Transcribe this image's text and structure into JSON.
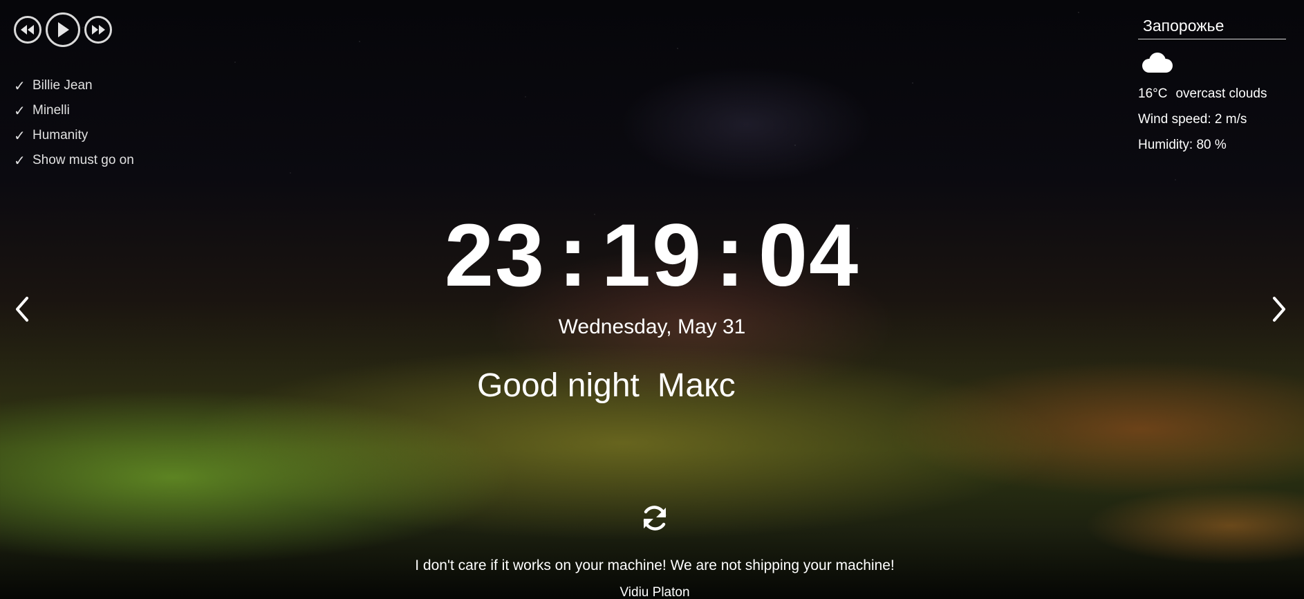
{
  "player": {
    "prev_icon": "rewind-icon",
    "play_icon": "play-icon",
    "next_icon": "fast-forward-icon"
  },
  "playlist": [
    {
      "title": "Billie Jean",
      "check": "✓"
    },
    {
      "title": "Minelli",
      "check": "✓"
    },
    {
      "title": "Humanity",
      "check": "✓"
    },
    {
      "title": "Show must go on",
      "check": "✓"
    }
  ],
  "weather": {
    "city": "Запорожье",
    "icon": "cloud-icon",
    "temperature": "16°C",
    "description": "overcast clouds",
    "wind": "Wind speed: 2 m/s",
    "humidity": "Humidity: 80 %"
  },
  "clock": {
    "hours": "23",
    "minutes": "19",
    "seconds": "04",
    "separator": ":"
  },
  "date": "Wednesday, May 31",
  "greeting": {
    "text": "Good night",
    "name": "Макс"
  },
  "navigation": {
    "prev_icon": "chevron-left-icon",
    "next_icon": "chevron-right-icon"
  },
  "quote": {
    "refresh_icon": "refresh-icon",
    "text": "I don't care if it works on your machine! We are not shipping your machine!",
    "author": "Vidiu Platon"
  }
}
